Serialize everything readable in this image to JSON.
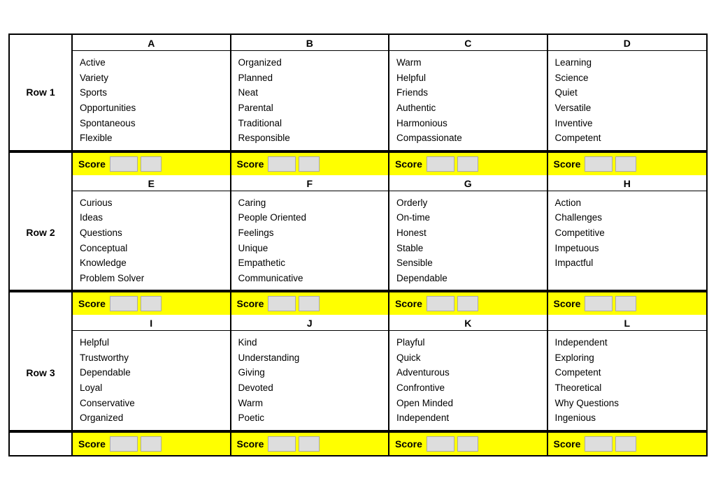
{
  "rows": [
    {
      "label": "Row 1",
      "cells": [
        {
          "header": "A",
          "items": [
            "Active",
            "Variety",
            "Sports",
            "Opportunities",
            "Spontaneous",
            "Flexible"
          ]
        },
        {
          "header": "B",
          "items": [
            "Organized",
            "Planned",
            "Neat",
            "Parental",
            "Traditional",
            "Responsible"
          ]
        },
        {
          "header": "C",
          "items": [
            "Warm",
            "Helpful",
            "Friends",
            "Authentic",
            "Harmonious",
            "Compassionate"
          ]
        },
        {
          "header": "D",
          "items": [
            "Learning",
            "Science",
            "Quiet",
            "Versatile",
            "Inventive",
            "Competent"
          ]
        }
      ],
      "scoreLabel": "Score"
    },
    {
      "label": "Row 2",
      "cells": [
        {
          "header": "E",
          "items": [
            "Curious",
            "Ideas",
            "Questions",
            "Conceptual",
            "Knowledge",
            "Problem Solver"
          ]
        },
        {
          "header": "F",
          "items": [
            "Caring",
            "People Oriented",
            "Feelings",
            "Unique",
            "Empathetic",
            "Communicative"
          ]
        },
        {
          "header": "G",
          "items": [
            "Orderly",
            "On-time",
            "Honest",
            "Stable",
            "Sensible",
            "Dependable"
          ]
        },
        {
          "header": "H",
          "items": [
            "Action",
            "Challenges",
            "Competitive",
            "Impetuous",
            "Impactful"
          ]
        }
      ],
      "scoreLabel": "Score"
    },
    {
      "label": "Row 3",
      "cells": [
        {
          "header": "I",
          "items": [
            "Helpful",
            "Trustworthy",
            "Dependable",
            "Loyal",
            "Conservative",
            "Organized"
          ]
        },
        {
          "header": "J",
          "items": [
            "Kind",
            "Understanding",
            "Giving",
            "Devoted",
            "Warm",
            "Poetic"
          ]
        },
        {
          "header": "K",
          "items": [
            "Playful",
            "Quick",
            "Adventurous",
            "Confrontive",
            "Open Minded",
            "Independent"
          ]
        },
        {
          "header": "L",
          "items": [
            "Independent",
            "Exploring",
            "Competent",
            "Theoretical",
            "Why Questions",
            "Ingenious"
          ]
        }
      ],
      "scoreLabel": "Score"
    }
  ]
}
